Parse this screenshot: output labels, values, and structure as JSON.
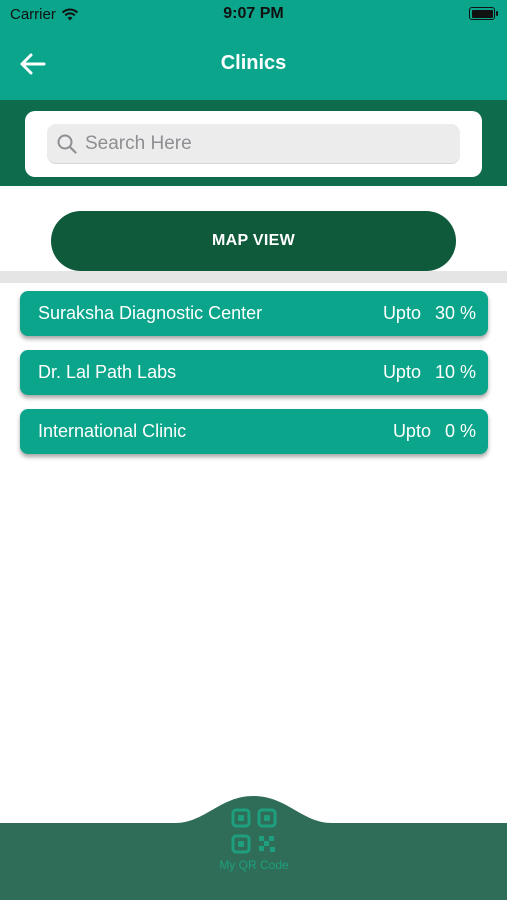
{
  "status_bar": {
    "carrier": "Carrier",
    "time": "9:07 PM"
  },
  "nav": {
    "title": "Clinics"
  },
  "search": {
    "placeholder": "Search Here"
  },
  "map_button": {
    "label": "MAP VIEW"
  },
  "clinics": [
    {
      "name": "Suraksha Diagnostic Center",
      "upto_label": "Upto",
      "discount": "30 %"
    },
    {
      "name": "Dr. Lal Path Labs",
      "upto_label": "Upto",
      "discount": "10 %"
    },
    {
      "name": "International Clinic",
      "upto_label": "Upto",
      "discount": "0 %"
    }
  ],
  "bottom_bar": {
    "qr_label": "My QR Code"
  },
  "colors": {
    "primary": "#0aa58a",
    "dark_green": "#0e5a3b",
    "band_green": "#0e6b4c",
    "bottom_bar": "#2f6d58"
  }
}
